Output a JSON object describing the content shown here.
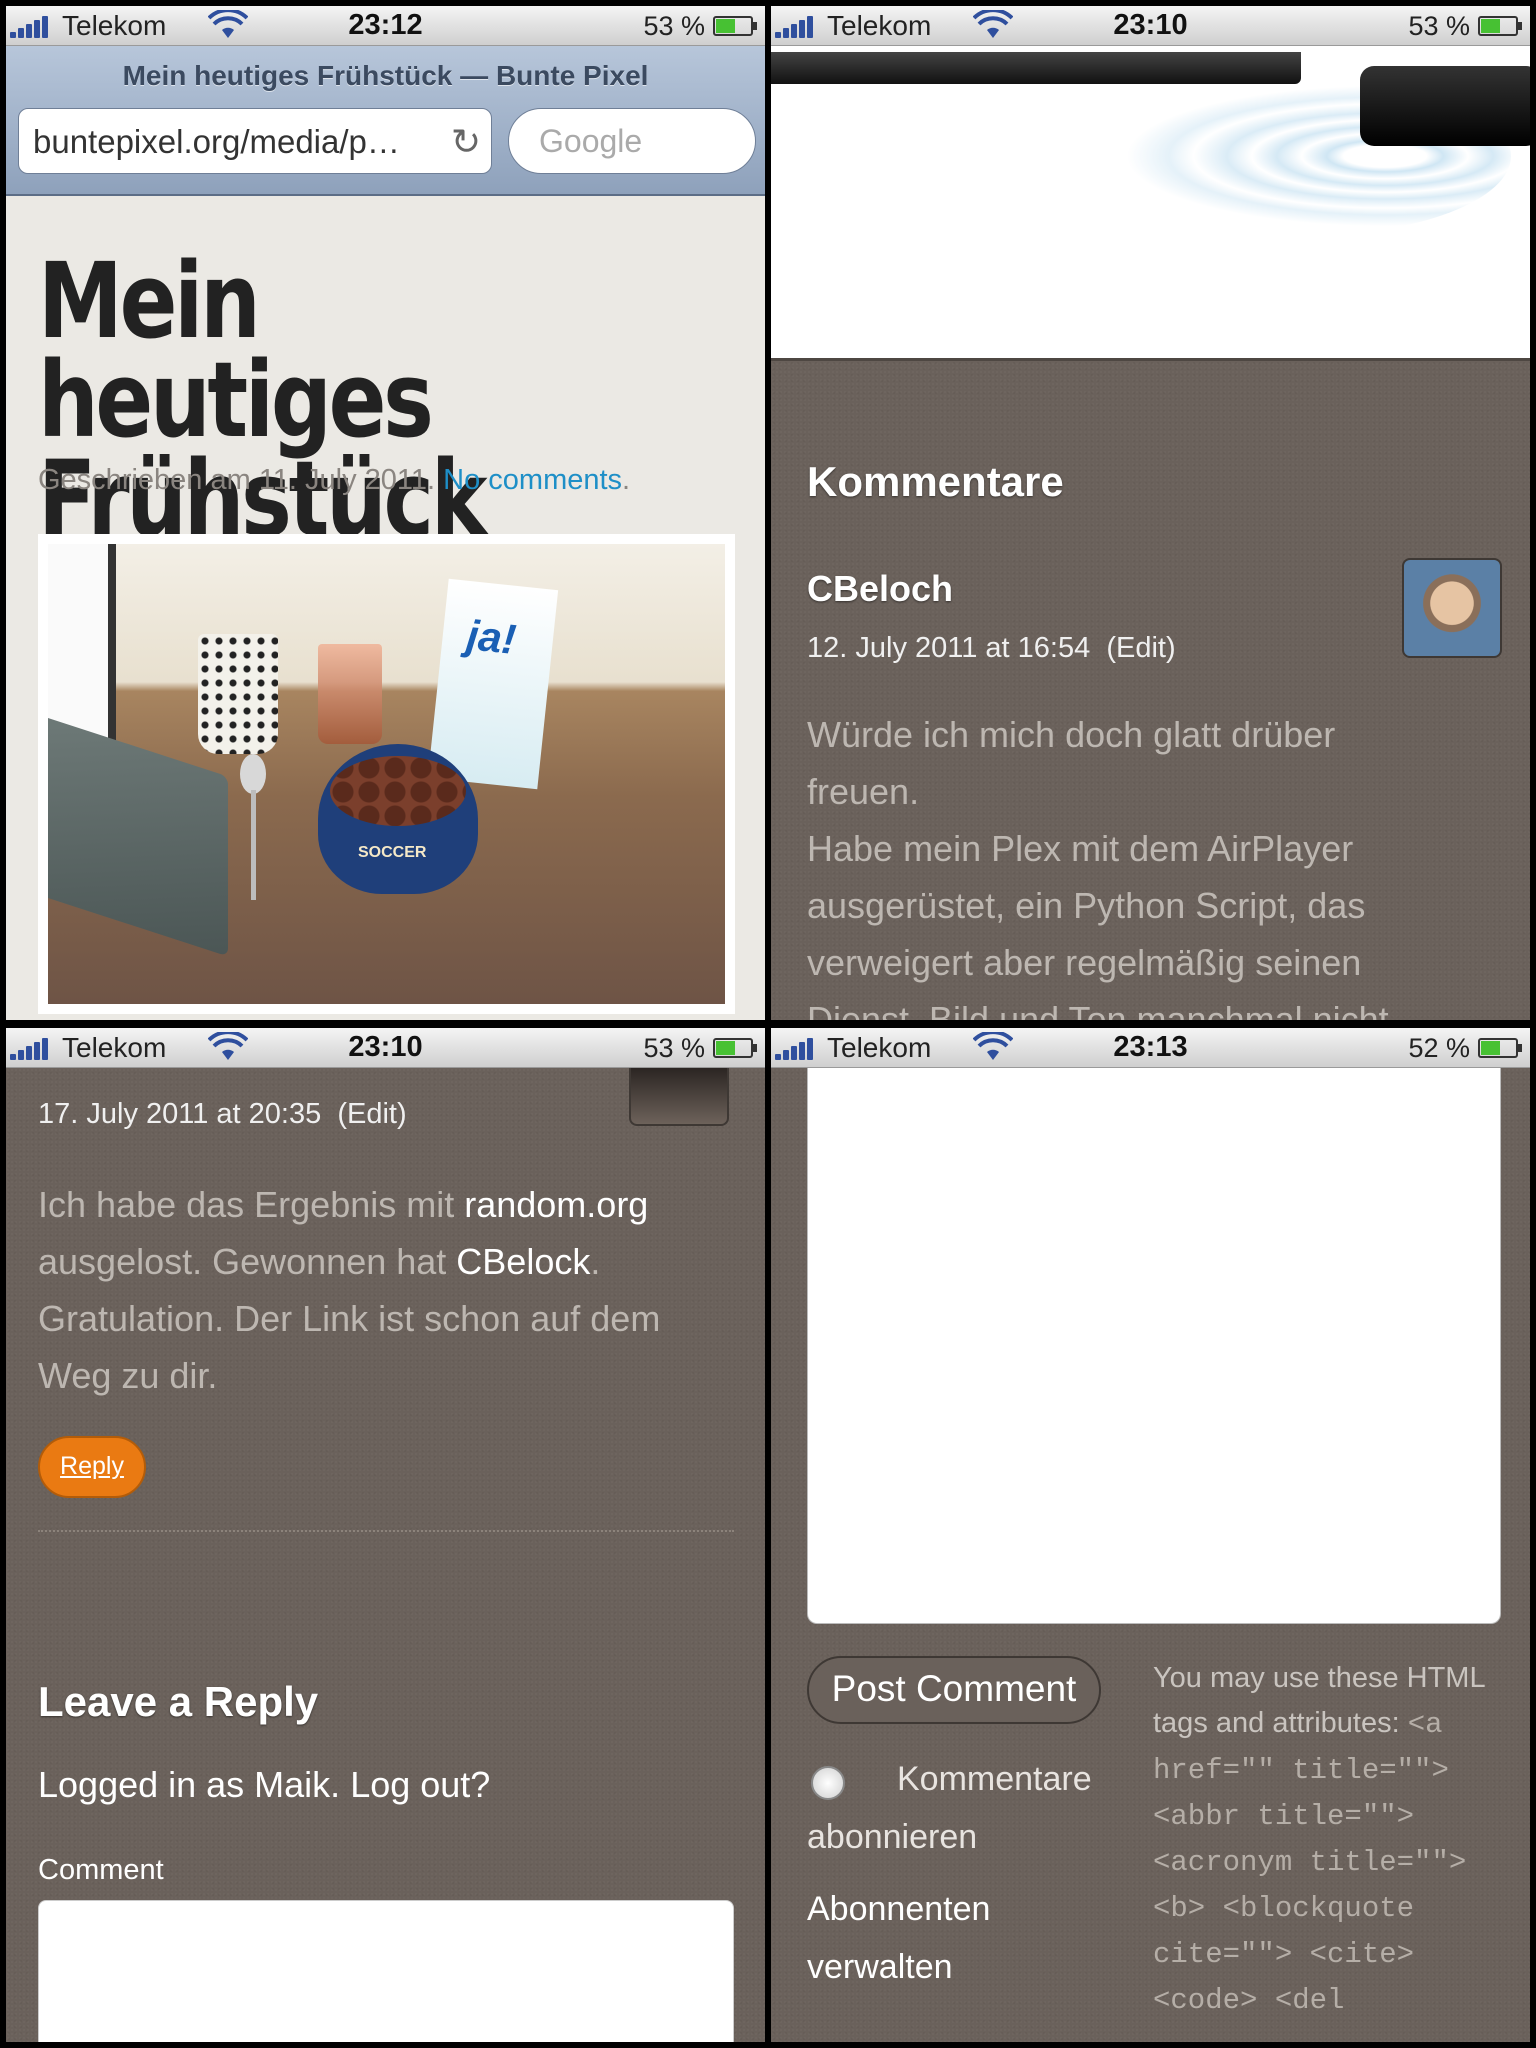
{
  "status_bars": [
    {
      "carrier": "Telekom",
      "time": "23:12",
      "battery_pct": "53 %",
      "battery_level": 0.53
    },
    {
      "carrier": "Telekom",
      "time": "23:10",
      "battery_pct": "53 %",
      "battery_level": 0.53
    },
    {
      "carrier": "Telekom",
      "time": "23:10",
      "battery_pct": "53 %",
      "battery_level": 0.53
    },
    {
      "carrier": "Telekom",
      "time": "23:13",
      "battery_pct": "52 %",
      "battery_level": 0.52
    }
  ],
  "safari": {
    "page_title": "Mein heutiges Frühstück — Bunte Pixel",
    "url": "buntepixel.org/media/p…",
    "search_placeholder": "Google"
  },
  "post": {
    "title_line1": "Mein heutiges",
    "title_line2": "Frühstück",
    "meta_prefix": "Geschrieben am 11. July 2011.",
    "meta_link": "No comments",
    "meta_suffix": "."
  },
  "comments_section": {
    "heading": "Kommentare",
    "comment1": {
      "author": "CBeloch",
      "date": "12. July 2011 at 16:54",
      "edit": "(Edit)",
      "body_lines": [
        "Würde ich mich doch glatt drüber",
        "freuen.",
        "Habe mein Plex mit dem AirPlayer",
        "ausgerüstet, ein Python Script, das",
        "verweigert aber regelmäßig seinen",
        "Dienst. Bild und Ton manchmal nicht"
      ]
    },
    "comment2": {
      "date": "17. July 2011 at 20:35",
      "edit": "(Edit)",
      "body_part1": "Ich habe das Ergebnis mit ",
      "link1": "random.org",
      "body_part2": " ausgelost. Gewonnen hat ",
      "link2": "CBelock",
      "body_part3": ". Gratulation. Der Link ist schon auf dem Weg zu dir.",
      "reply_label": "Reply"
    }
  },
  "reply_form": {
    "heading": "Leave a Reply",
    "logged_in": "Logged in as Maik. Log out?",
    "comment_label": "Comment",
    "post_button": "Post Comment",
    "subscribe_label": "Kommentare abonnieren",
    "manage_label": "Abonnenten verwalten",
    "html_hint": "You may use these HTML tags and attributes:",
    "html_tags": "<a href=\"\" title=\"\"> <abbr title=\"\"> <acronym title=\"\"> <b> <blockquote cite=\"\"> <cite> <code> <del"
  },
  "photo": {
    "carton_label": "ja!",
    "bowl_label": "SOCCER"
  },
  "colors": {
    "accent_link": "#1e8fc7",
    "reply_button": "#ea7a12",
    "comment_bg": "#6a615b"
  }
}
